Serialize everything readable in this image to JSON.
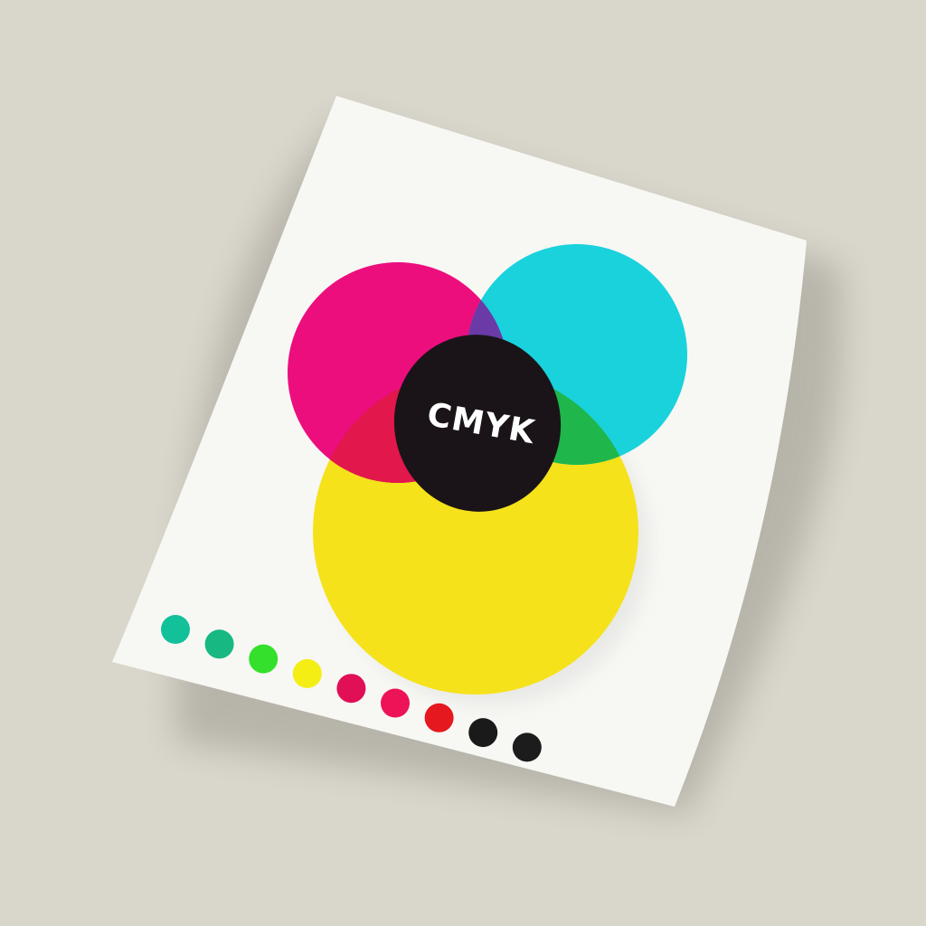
{
  "scene": {
    "description_free_label": "CMYK",
    "colors": {
      "background": "#d9d6cb",
      "paper": "#f7f7f4",
      "shadow": "#8f8c84",
      "magenta": "#ec0e7d",
      "cyan": "#19d2dc",
      "yellow": "#f5e21a",
      "black": "#1a1418",
      "blue_overlap": "#3a7ccc",
      "purple_overlap": "#6a3aa6",
      "red_overlap": "#e2174c",
      "green_overlap": "#1fb64b"
    },
    "swatches": [
      "#12c09a",
      "#17b882",
      "#34e02b",
      "#f4ee14",
      "#e00f56",
      "#ec1456",
      "#e5171f",
      "#1a1a1a",
      "#1c1c1c"
    ]
  }
}
